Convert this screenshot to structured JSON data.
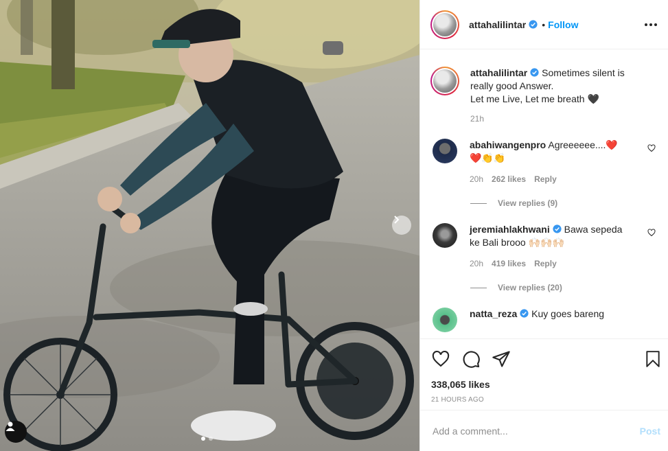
{
  "post": {
    "author": "attahalilintar",
    "follow_label": "Follow",
    "follow_separator": "•"
  },
  "caption": {
    "username": "attahalilintar",
    "text_line1": "Sometimes silent is really good Answer.",
    "text_line2": "Let me Live, Let me breath",
    "text_emoji": "🖤",
    "time": "21h"
  },
  "comments": [
    {
      "username": "abahiwangenpro",
      "text": "Agreeeeee....",
      "emojis": "❤️❤️👏👏",
      "time": "20h",
      "likes": "262 likes",
      "reply_label": "Reply",
      "view_replies": "View replies (9)"
    },
    {
      "username": "jeremiahlakhwani",
      "text": "Bawa sepeda ke Bali brooo",
      "emojis": "🙌🏻🙌🏻🙌🏻",
      "time": "20h",
      "likes": "419 likes",
      "reply_label": "Reply",
      "view_replies": "View replies (20)"
    },
    {
      "username": "natta_reza",
      "text": "Kuy goes bareng"
    }
  ],
  "actions": {
    "likes": "338,065 likes",
    "time_ago": "21 HOURS AGO"
  },
  "add_comment": {
    "placeholder": "Add a comment...",
    "post_label": "Post"
  },
  "colors": {
    "accent": "#0095f6",
    "post_disabled": "#b2dffc",
    "verified": "#3897f0"
  },
  "icons": {
    "like": "heart-icon",
    "comment": "comment-icon",
    "share": "paper-plane-icon",
    "save": "bookmark-icon",
    "more": "more-horizontal-icon",
    "next": "chevron-right-icon",
    "tags": "user-tag-icon"
  }
}
